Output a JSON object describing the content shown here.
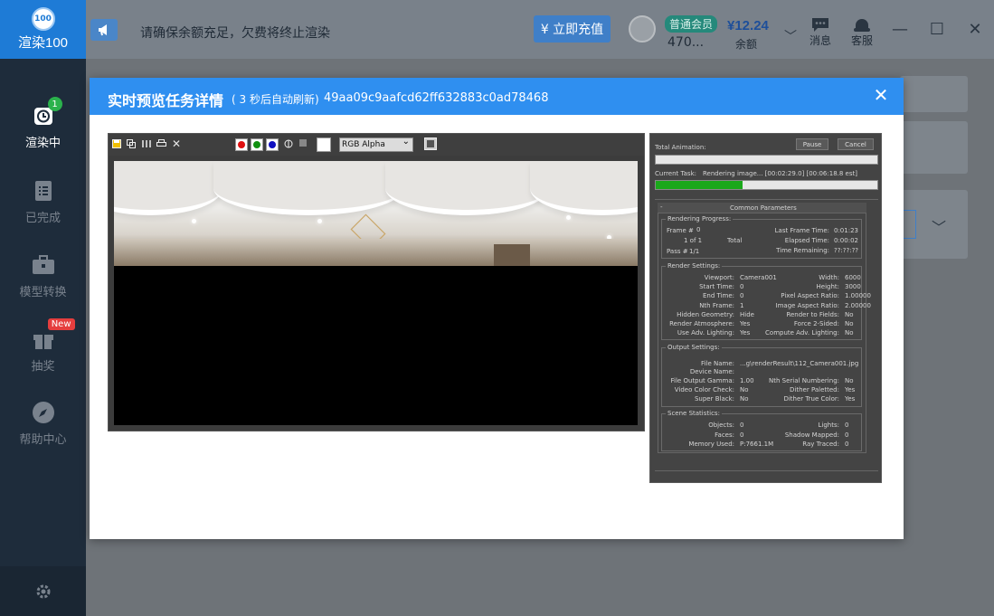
{
  "app": {
    "logo_mark": "100",
    "logo_text": "渲染100"
  },
  "sidebar": {
    "items": [
      {
        "label": "渲染中",
        "icon": "clock-icon",
        "badge": "1"
      },
      {
        "label": "已完成",
        "icon": "list-icon"
      },
      {
        "label": "模型转换",
        "icon": "briefcase-icon"
      },
      {
        "label": "抽奖",
        "icon": "gift-icon",
        "badge": "New"
      },
      {
        "label": "帮助中心",
        "icon": "compass-icon"
      }
    ],
    "settings_icon": "gear-icon"
  },
  "topbar": {
    "notice": "请确保余额充足，欠费将终止渲染",
    "recharge": "¥ 立即充值",
    "member_level": "普通会员",
    "user_id": "470...",
    "balance": "¥12.24",
    "balance_label": "余额",
    "messages": "消息",
    "service": "客服"
  },
  "modal": {
    "title": "实时预览任务详情",
    "refresh_note": "( 3 秒后自动刷新)",
    "task_id": "49aa09c9aafcd62ff632883c0ad78468",
    "close_icon": "close-icon"
  },
  "frame_buffer": {
    "channel": "RGB Alpha"
  },
  "render_panel": {
    "total_animation": "Total Animation:",
    "pause": "Pause",
    "cancel": "Cancel",
    "current_task_label": "Current Task:",
    "current_task_value": "Rendering image... [00:02:29.0] [00:06:18.8 est]",
    "task_progress": 0.39,
    "common_params": "Common Parameters",
    "collapse": "-",
    "progress": {
      "title": "Rendering Progress:",
      "frame_label": "Frame #",
      "frame_value": "0",
      "of_label": "1 of 1",
      "total_label": "Total",
      "pass_label": "Pass #",
      "pass_value": "1/1",
      "last_frame_label": "Last Frame Time:",
      "last_frame_value": "0:01:23",
      "elapsed_label": "Elapsed Time:",
      "elapsed_value": "0:00:02",
      "remaining_label": "Time Remaining:",
      "remaining_value": "??:??:??"
    },
    "render_settings": {
      "title": "Render Settings:",
      "rows": [
        {
          "l": "Viewport:",
          "lv": "Camera001",
          "r": "Width:",
          "rv": "6000"
        },
        {
          "l": "Start Time:",
          "lv": "0",
          "r": "Height:",
          "rv": "3000"
        },
        {
          "l": "End Time:",
          "lv": "0",
          "r": "Pixel Aspect Ratio:",
          "rv": "1.00000"
        },
        {
          "l": "Nth Frame:",
          "lv": "1",
          "r": "Image Aspect Ratio:",
          "rv": "2.00000"
        },
        {
          "l": "Hidden Geometry:",
          "lv": "Hide",
          "r": "Render to Fields:",
          "rv": "No"
        },
        {
          "l": "Render Atmosphere:",
          "lv": "Yes",
          "r": "Force 2-Sided:",
          "rv": "No"
        },
        {
          "l": "Use Adv. Lighting:",
          "lv": "Yes",
          "r": "Compute Adv. Lighting:",
          "rv": "No"
        }
      ]
    },
    "output_settings": {
      "title": "Output Settings:",
      "file_name_label": "File Name:",
      "file_name_value": "...g\\renderResult\\112_Camera001.jpg",
      "device_label": "Device Name:",
      "rows": [
        {
          "l": "File Output Gamma:",
          "lv": "1.00",
          "r": "Nth Serial Numbering:",
          "rv": "No"
        },
        {
          "l": "Video Color Check:",
          "lv": "No",
          "r": "Dither Paletted:",
          "rv": "Yes"
        },
        {
          "l": "Super Black:",
          "lv": "No",
          "r": "Dither True Color:",
          "rv": "Yes"
        }
      ]
    },
    "scene_stats": {
      "title": "Scene Statistics:",
      "rows": [
        {
          "l": "Objects:",
          "lv": "0",
          "r": "Lights:",
          "rv": "0"
        },
        {
          "l": "Faces:",
          "lv": "0",
          "r": "Shadow Mapped:",
          "rv": "0"
        },
        {
          "l": "Memory Used:",
          "lv": "P:7661.1M",
          "r": "Ray Traced:",
          "rv": "0"
        }
      ]
    }
  }
}
